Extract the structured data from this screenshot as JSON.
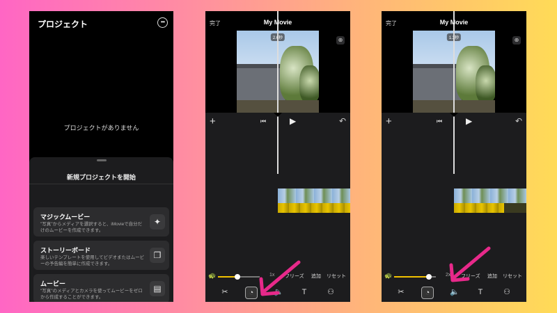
{
  "screen1": {
    "title": "プロジェクト",
    "more_icon": "ellipsis-circle-icon",
    "empty_message": "プロジェクトがありません",
    "sheet_title": "新規プロジェクトを開始",
    "options": [
      {
        "title": "マジックムービー",
        "desc": "\"写真\"からメディアを選択すると、iMovieで自分だけのムービーを作成できます。",
        "icon": "magic-wand-icon"
      },
      {
        "title": "ストーリーボード",
        "desc": "楽しいテンプレートを使用してビデオまたはムービーの予告編を簡単に作成できます。",
        "icon": "storyboard-icon"
      },
      {
        "title": "ムービー",
        "desc": "\"写真\"のメディアとカメラを使ってムービーをゼロから作成することができます。",
        "icon": "film-icon"
      }
    ]
  },
  "editor": {
    "done_label": "完了",
    "movie_title": "My Movie",
    "zoom_icon": "zoom-icon",
    "speed_values": [
      "1x",
      "2x"
    ],
    "freeze_label": "フリーズ",
    "add_label": "追加",
    "reset_label": "リセット",
    "tools": [
      "scissors-icon",
      "speed-icon",
      "audio-icon",
      "text-icon",
      "filter-icon"
    ]
  },
  "screens": [
    {
      "duration_badge": "2.6秒",
      "speed_level": 0.47,
      "speed_label": "1x"
    },
    {
      "duration_badge": "1.3秒",
      "speed_level": 0.83,
      "speed_label": "2x"
    }
  ],
  "colors": {
    "accent_yellow": "#f2c200",
    "arrow_pink": "#e7298a",
    "card_title_blue": "#ffffff"
  }
}
